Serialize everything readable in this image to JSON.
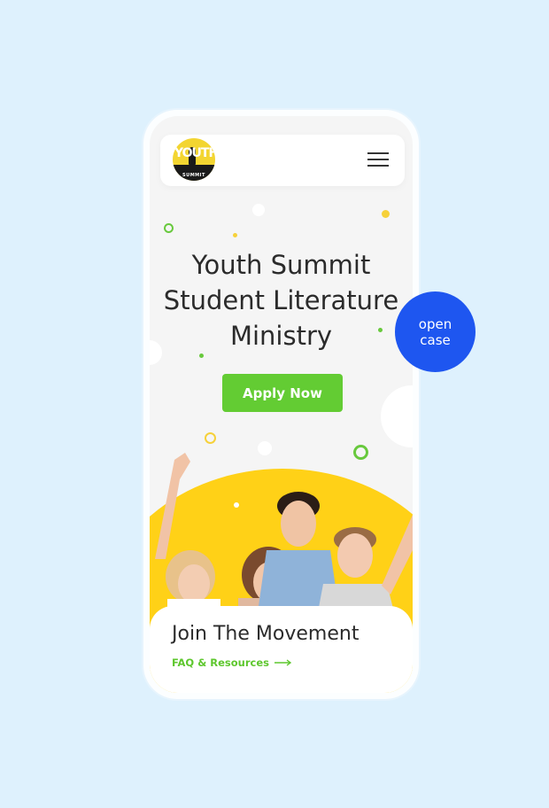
{
  "brand": {
    "logo_word": "YOUTH",
    "logo_sub": "SUMMIT"
  },
  "hero": {
    "title_line1": "Youth Summit",
    "title_line2": "Student Literature",
    "title_line3": "Ministry",
    "cta_label": "Apply Now"
  },
  "card": {
    "title": "Join The Movement",
    "link_label": "FAQ & Resources"
  },
  "badge": {
    "line1": "open",
    "line2": "case"
  },
  "icons": {
    "menu": "hamburger-icon",
    "link_arrow": "arrow-right-icon"
  },
  "colors": {
    "background": "#def1fd",
    "accent_green": "#63cc33",
    "accent_yellow": "#ffd117",
    "badge_blue": "#1e56f0"
  }
}
